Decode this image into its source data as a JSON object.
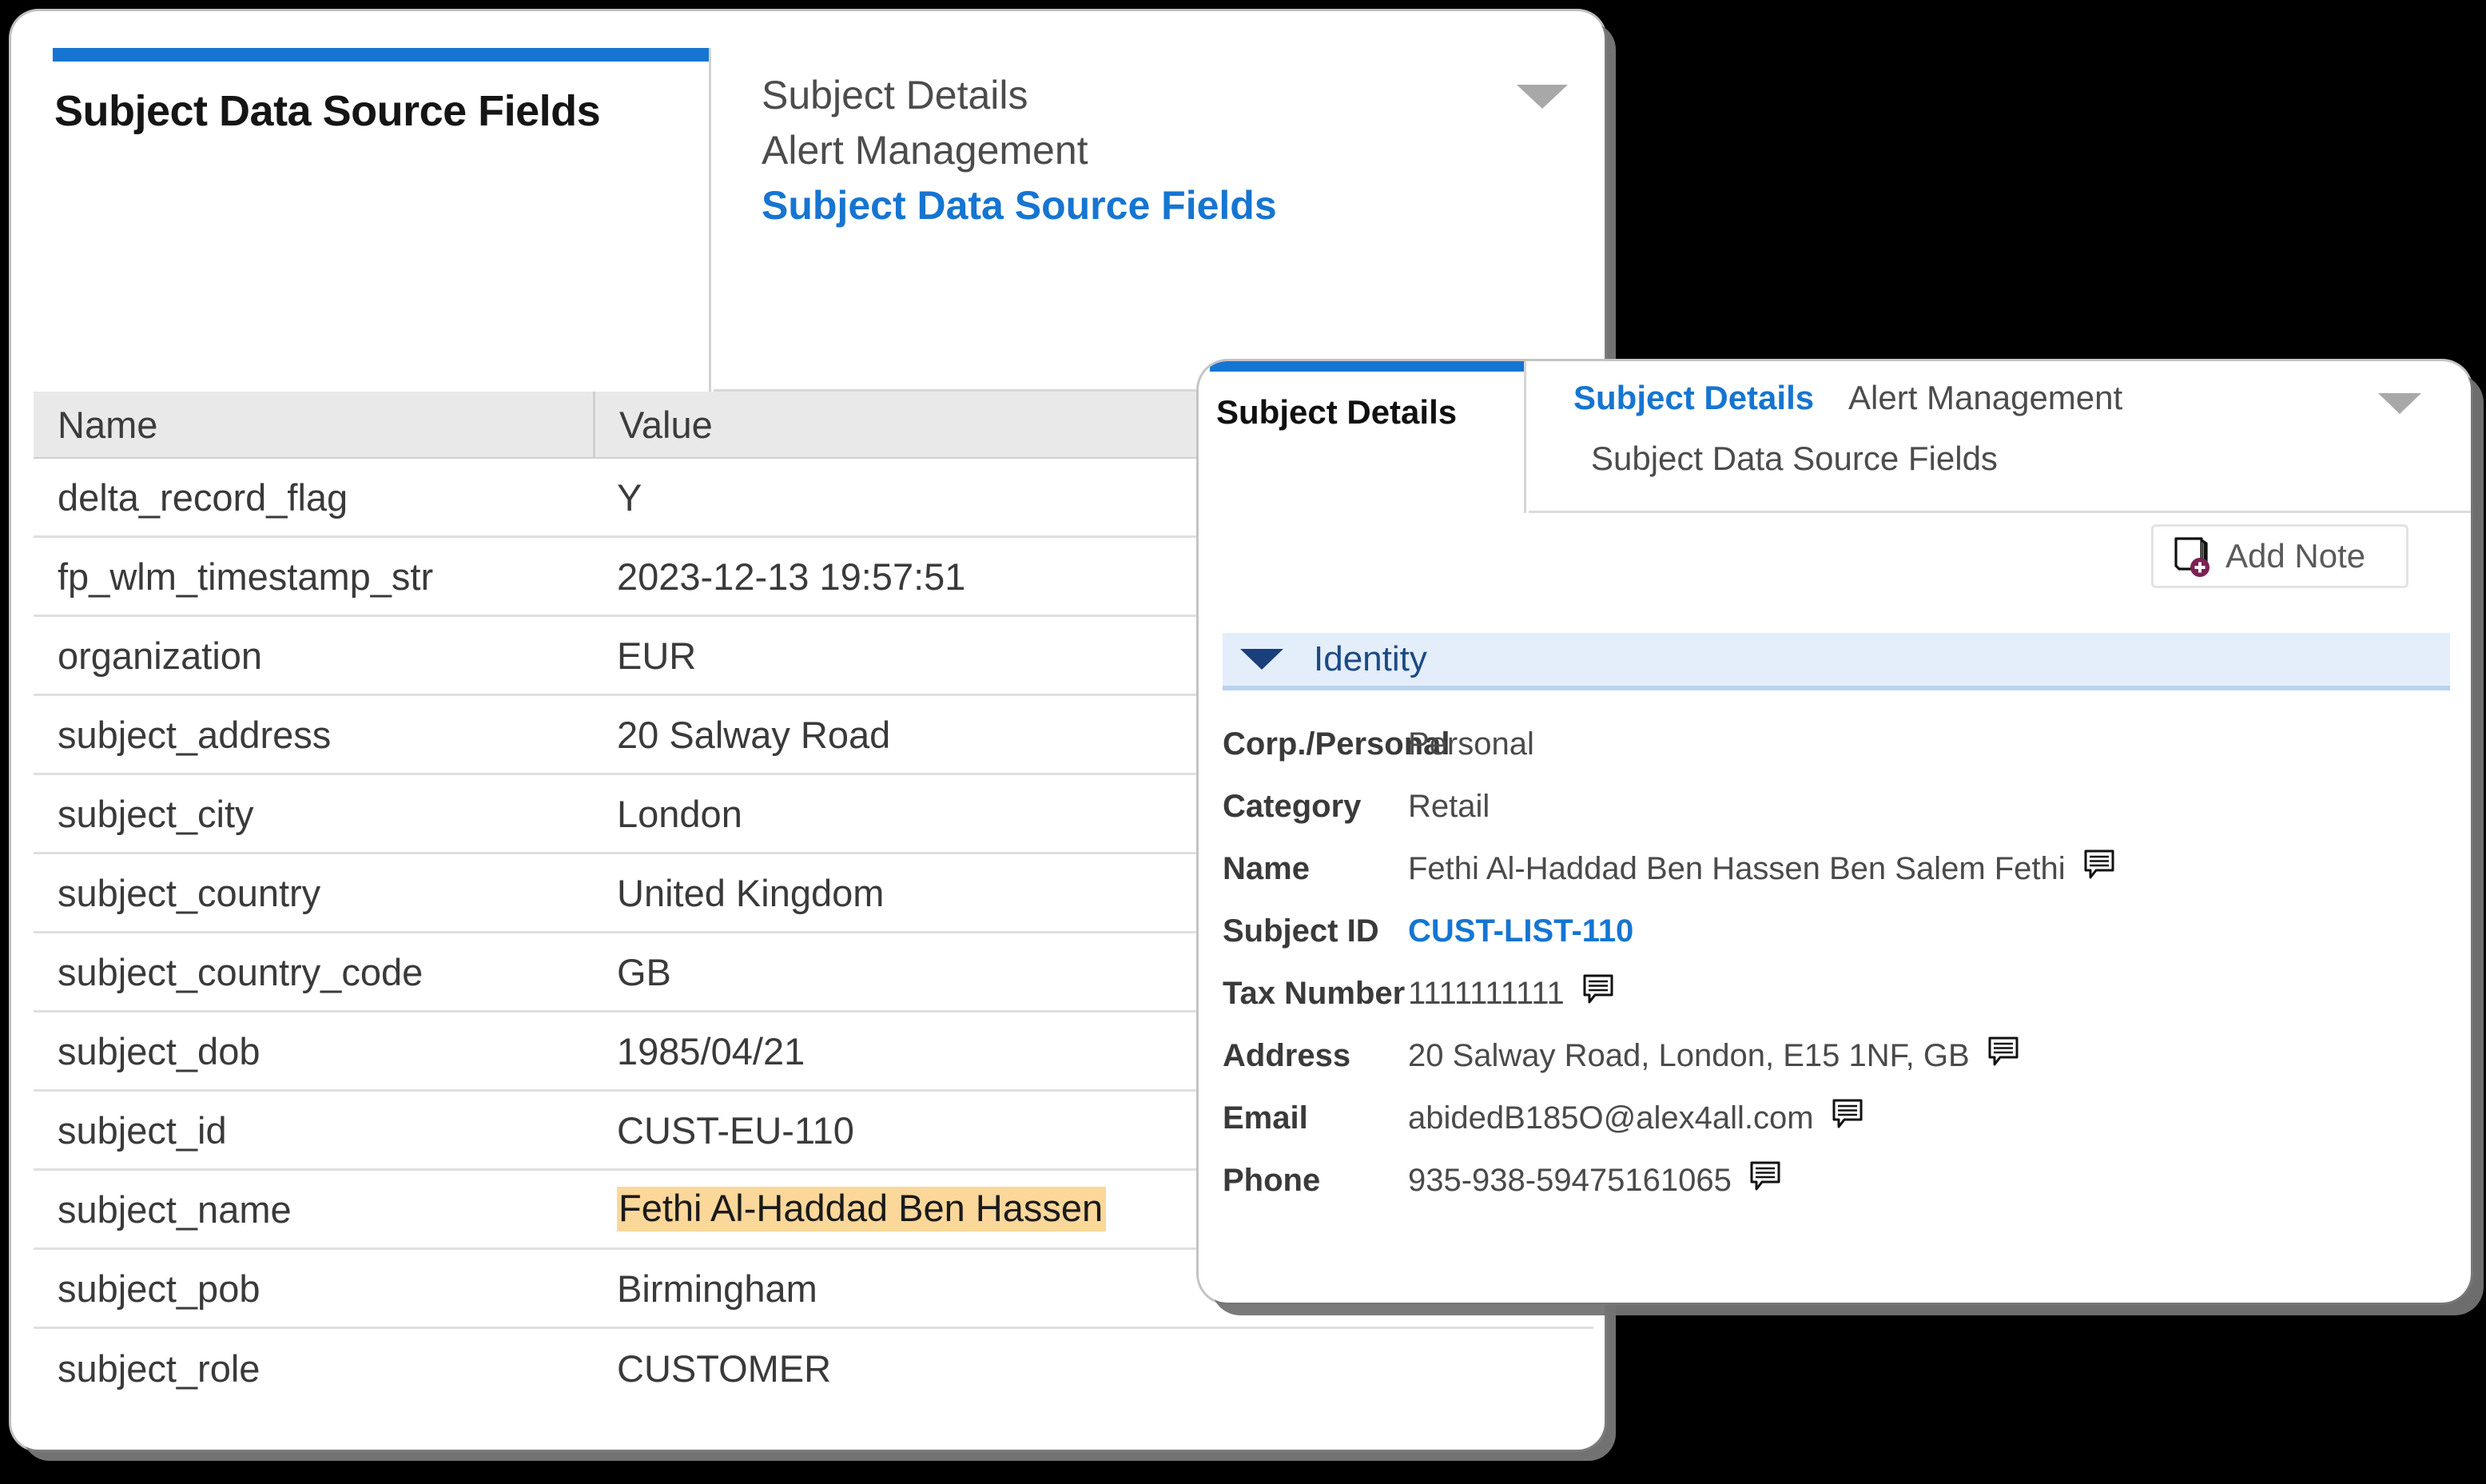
{
  "back_panel": {
    "tab_title": "Subject Data Source Fields",
    "dropdown": {
      "items": [
        {
          "label": "Subject Details",
          "active": false
        },
        {
          "label": "Alert Management",
          "active": false
        },
        {
          "label": "Subject Data Source Fields",
          "active": true
        }
      ],
      "caret_icon": "chevron-down-icon"
    },
    "table": {
      "columns": [
        "Name",
        "Value"
      ],
      "rows": [
        {
          "name": "delta_record_flag",
          "value": "Y",
          "highlighted": false
        },
        {
          "name": "fp_wlm_timestamp_str",
          "value": "2023-12-13 19:57:51",
          "highlighted": false
        },
        {
          "name": "organization",
          "value": "EUR",
          "highlighted": false
        },
        {
          "name": "subject_address",
          "value": "20 Salway Road",
          "highlighted": false
        },
        {
          "name": "subject_city",
          "value": "London",
          "highlighted": false
        },
        {
          "name": "subject_country",
          "value": "United Kingdom",
          "highlighted": false
        },
        {
          "name": "subject_country_code",
          "value": "GB",
          "highlighted": false
        },
        {
          "name": "subject_dob",
          "value": "1985/04/21",
          "highlighted": false
        },
        {
          "name": "subject_id",
          "value": "CUST-EU-110",
          "highlighted": false
        },
        {
          "name": "subject_name",
          "value": "Fethi Al-Haddad Ben Hassen",
          "highlighted": true
        },
        {
          "name": "subject_pob",
          "value": "Birmingham",
          "highlighted": false
        },
        {
          "name": "subject_role",
          "value": "CUSTOMER",
          "highlighted": false
        }
      ]
    }
  },
  "front_panel": {
    "tab_title": "Subject Details",
    "dropdown": {
      "items": [
        {
          "label": "Subject Details",
          "active": true
        },
        {
          "label": "Alert Management",
          "active": false
        },
        {
          "label": "Subject Data Source Fields",
          "active": false
        }
      ],
      "caret_icon": "chevron-down-icon"
    },
    "add_note": {
      "label": "Add Note",
      "icon": "add-note-icon"
    },
    "section": {
      "title": "Identity",
      "expanded": true,
      "caret_icon": "caret-down-icon"
    },
    "fields": [
      {
        "key": "Corp./Personal",
        "value": "Personal",
        "note": false,
        "link": false
      },
      {
        "key": "Category",
        "value": "Retail",
        "note": false,
        "link": false
      },
      {
        "key": "Name",
        "value": "Fethi Al-Haddad Ben Hassen Ben Salem Fethi",
        "note": true,
        "link": false
      },
      {
        "key": "Subject ID",
        "value": "CUST-LIST-110",
        "note": false,
        "link": true
      },
      {
        "key": "Tax Number",
        "value": "1111111111",
        "note": true,
        "link": false
      },
      {
        "key": "Address",
        "value": "20 Salway Road, London, E15 1NF, GB",
        "note": true,
        "link": false
      },
      {
        "key": "Email",
        "value": "abidedB185O@alex4all.com",
        "note": true,
        "link": false
      },
      {
        "key": "Phone",
        "value": "935-938-59475161065",
        "note": true,
        "link": false
      }
    ]
  },
  "colors": {
    "accent_blue": "#1675d1",
    "link_blue": "#1675d1",
    "highlight_amber": "#fbd79a",
    "section_bg": "#e4eefb",
    "section_text": "#1c4a85",
    "note_badge_purple": "#7a2252"
  }
}
